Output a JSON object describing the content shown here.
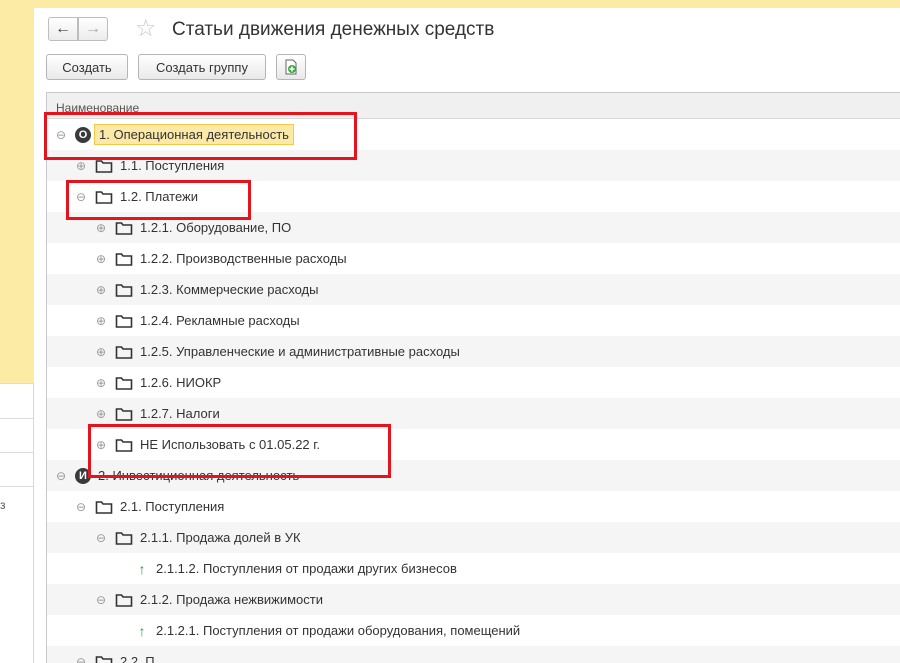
{
  "window": {
    "title": "Статьи движения денежных средств"
  },
  "toolbar": {
    "create_label": "Создать",
    "create_group_label": "Создать группу"
  },
  "left_panel": {
    "fragment": "з"
  },
  "grid": {
    "column_name": "Наименование",
    "rows": [
      {
        "label": "1. Операционная деятельность",
        "level": 0,
        "expander": "minus",
        "icon": "circle-o-icon",
        "icon_text": "О",
        "selected": true
      },
      {
        "label": "1.1. Поступления",
        "level": 1,
        "expander": "plus",
        "icon": "folder-icon"
      },
      {
        "label": "1.2. Платежи",
        "level": 1,
        "expander": "minus",
        "icon": "folder-icon"
      },
      {
        "label": "1.2.1. Оборудование, ПО",
        "level": 2,
        "expander": "plus",
        "icon": "folder-icon"
      },
      {
        "label": "1.2.2. Производственные расходы",
        "level": 2,
        "expander": "plus",
        "icon": "folder-icon"
      },
      {
        "label": "1.2.3. Коммерческие расходы",
        "level": 2,
        "expander": "plus",
        "icon": "folder-icon"
      },
      {
        "label": "1.2.4. Рекламные расходы",
        "level": 2,
        "expander": "plus",
        "icon": "folder-icon"
      },
      {
        "label": "1.2.5. Управленческие и административные расходы",
        "level": 2,
        "expander": "plus",
        "icon": "folder-icon"
      },
      {
        "label": "1.2.6. НИОКР",
        "level": 2,
        "expander": "plus",
        "icon": "folder-icon"
      },
      {
        "label": "1.2.7. Налоги",
        "level": 2,
        "expander": "plus",
        "icon": "folder-icon"
      },
      {
        "label": "НЕ Использовать с 01.05.22 г.",
        "level": 2,
        "expander": "plus",
        "icon": "folder-icon"
      },
      {
        "label": "2. Инвестиционная деятельность",
        "level": 0,
        "expander": "minus",
        "icon": "circle-i-icon",
        "icon_text": "И"
      },
      {
        "label": "2.1. Поступления",
        "level": 1,
        "expander": "minus",
        "icon": "folder-icon"
      },
      {
        "label": "2.1.1. Продажа долей в УК",
        "level": 2,
        "expander": "minus",
        "icon": "folder-icon"
      },
      {
        "label": "2.1.1.2. Поступления от продажи других бизнесов",
        "level": 3,
        "expander": "none",
        "icon": "arrow-up-icon"
      },
      {
        "label": "2.1.2. Продажа нежвижимости",
        "level": 2,
        "expander": "minus",
        "icon": "folder-icon"
      },
      {
        "label": "2.1.2.1. Поступления от продажи оборудования, помещений",
        "level": 3,
        "expander": "none",
        "icon": "arrow-up-icon"
      },
      {
        "label": "2.2. П",
        "level": 1,
        "expander": "minus",
        "icon": "folder-icon"
      }
    ]
  }
}
